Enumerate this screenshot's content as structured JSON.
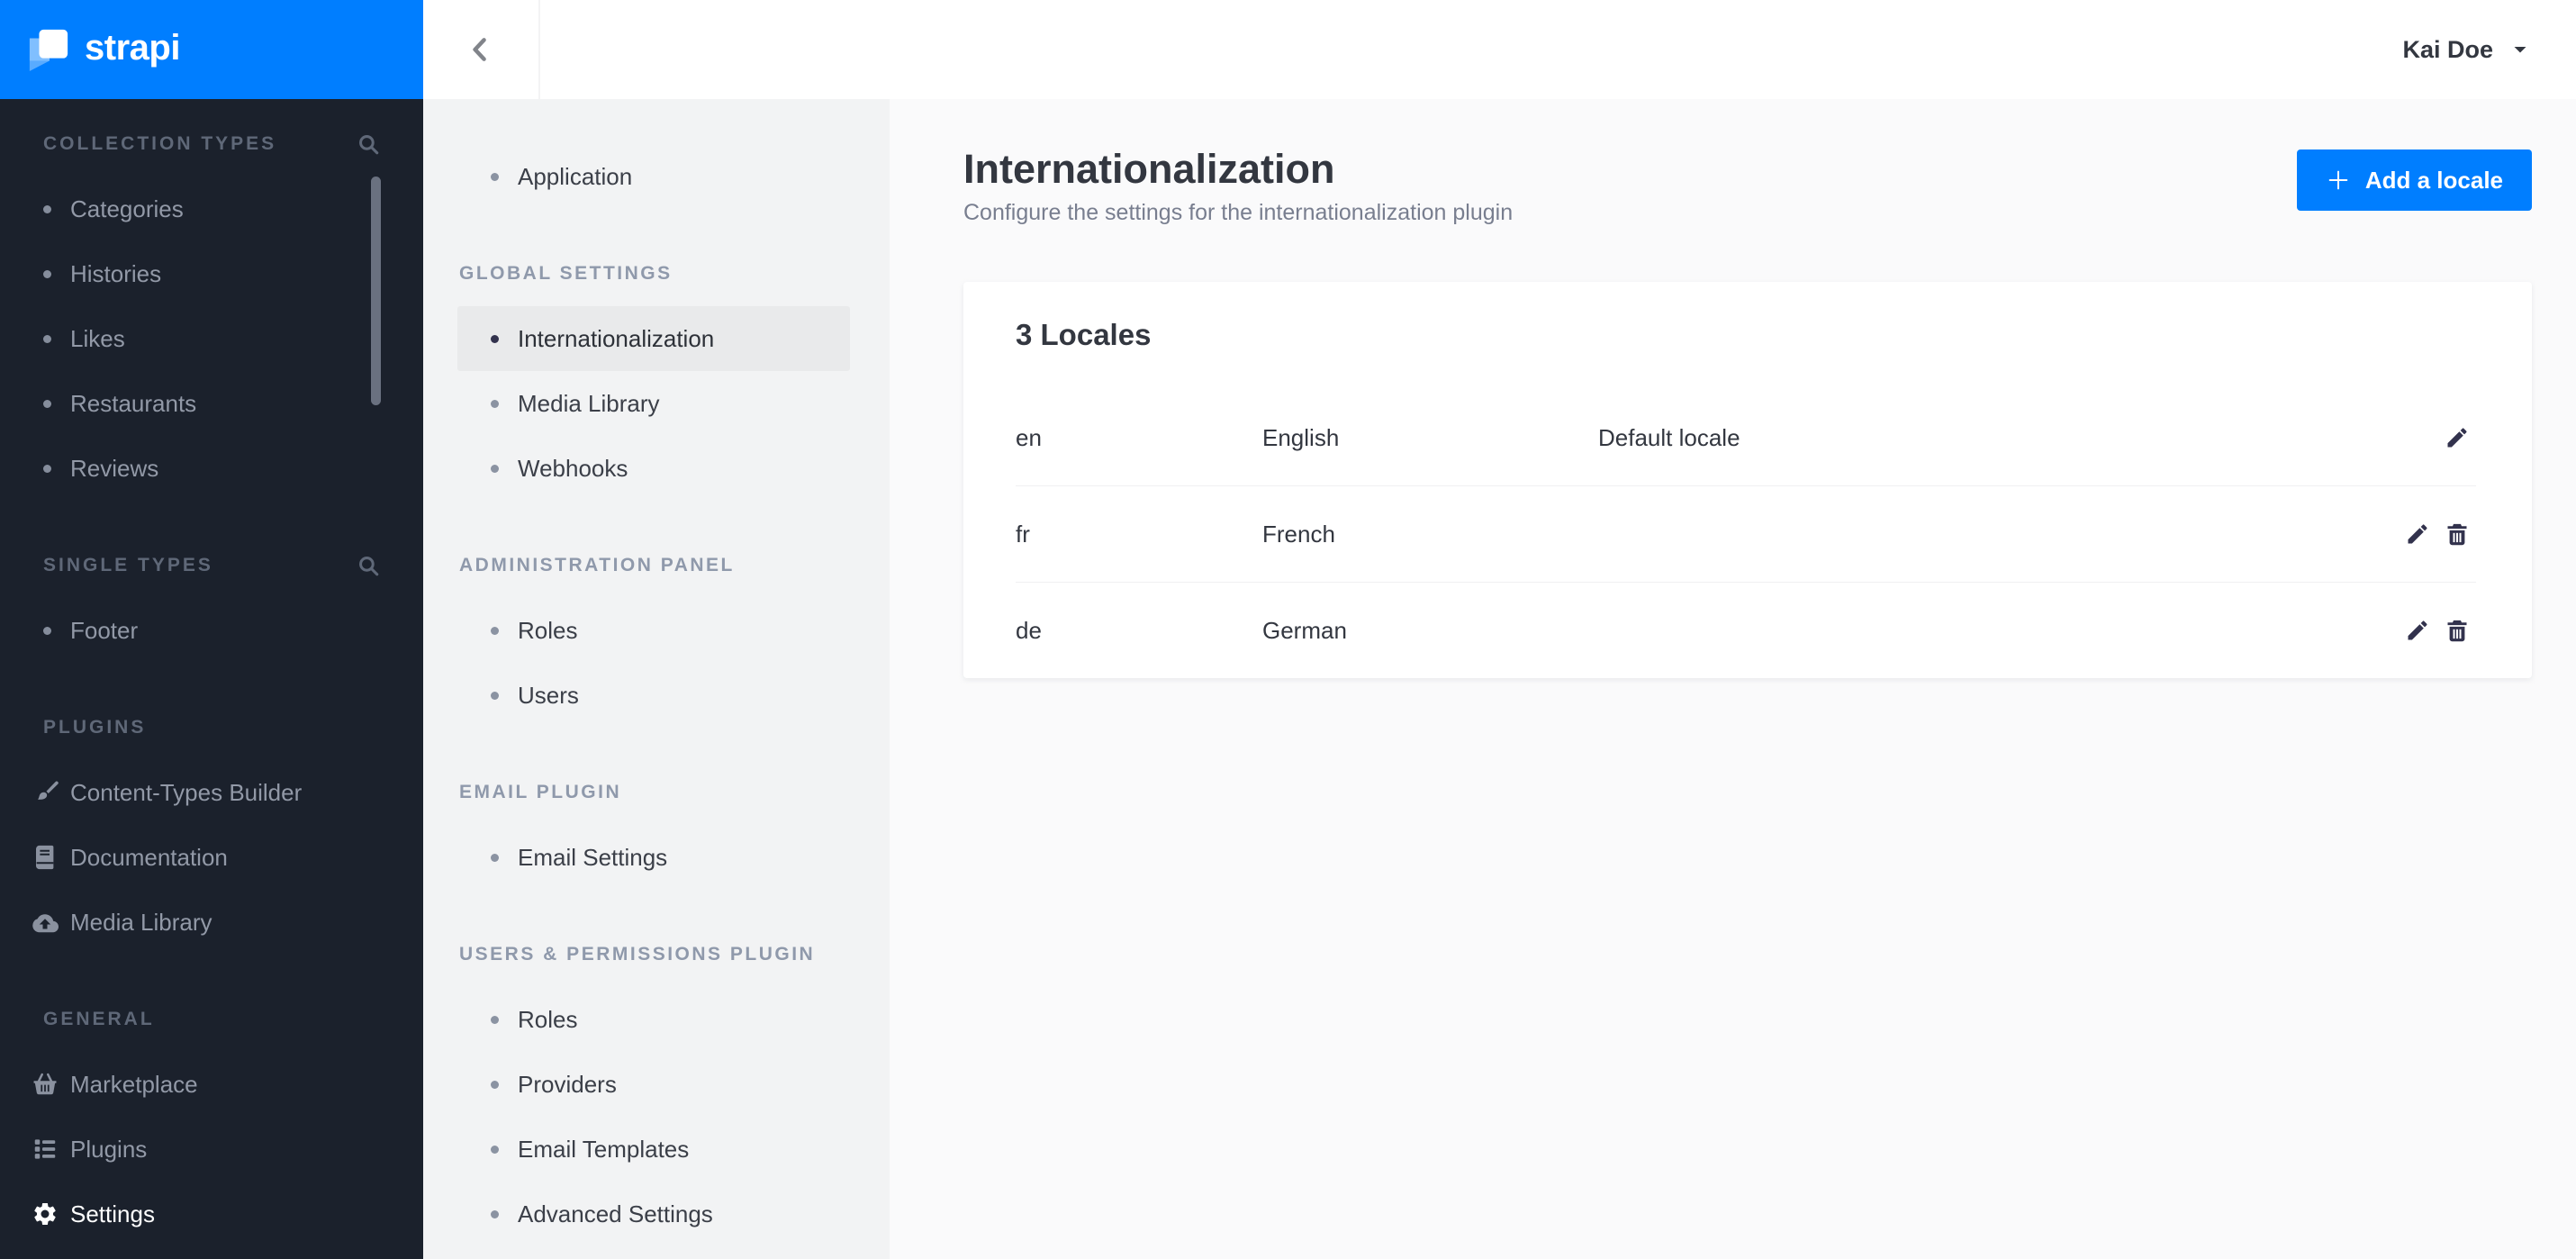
{
  "brand": {
    "name": "strapi",
    "accent_color": "#007eff",
    "sidebar_bg": "#1b212c"
  },
  "topbar": {
    "user_name": "Kai Doe",
    "back_icon": "chevron-left-icon",
    "caret_icon": "caret-down-icon"
  },
  "dark_sidebar": {
    "sections": [
      {
        "label": "COLLECTION TYPES",
        "search": true,
        "items": [
          {
            "label": "Categories"
          },
          {
            "label": "Histories"
          },
          {
            "label": "Likes"
          },
          {
            "label": "Restaurants"
          },
          {
            "label": "Reviews"
          }
        ]
      },
      {
        "label": "SINGLE TYPES",
        "search": true,
        "items": [
          {
            "label": "Footer"
          }
        ]
      },
      {
        "label": "PLUGINS",
        "search": false,
        "items": [
          {
            "label": "Content-Types Builder",
            "icon": "brush-icon"
          },
          {
            "label": "Documentation",
            "icon": "book-icon"
          },
          {
            "label": "Media Library",
            "icon": "cloud-upload-icon"
          }
        ]
      },
      {
        "label": "GENERAL",
        "search": false,
        "items": [
          {
            "label": "Marketplace",
            "icon": "basket-icon"
          },
          {
            "label": "Plugins",
            "icon": "list-icon"
          },
          {
            "label": "Settings",
            "icon": "gear-icon",
            "active": true
          }
        ]
      }
    ]
  },
  "settings_sidebar": {
    "top_items": [
      {
        "label": "Application"
      }
    ],
    "sections": [
      {
        "label": "GLOBAL SETTINGS",
        "items": [
          {
            "label": "Internationalization",
            "active": true
          },
          {
            "label": "Media Library"
          },
          {
            "label": "Webhooks"
          }
        ]
      },
      {
        "label": "ADMINISTRATION PANEL",
        "items": [
          {
            "label": "Roles"
          },
          {
            "label": "Users"
          }
        ]
      },
      {
        "label": "EMAIL PLUGIN",
        "items": [
          {
            "label": "Email Settings"
          }
        ]
      },
      {
        "label": "USERS & PERMISSIONS PLUGIN",
        "items": [
          {
            "label": "Roles"
          },
          {
            "label": "Providers"
          },
          {
            "label": "Email Templates"
          },
          {
            "label": "Advanced Settings"
          }
        ]
      }
    ]
  },
  "page": {
    "title": "Internationalization",
    "subtitle": "Configure the settings for the internationalization plugin",
    "add_button_label": "Add a locale"
  },
  "locales": {
    "count_title": "3 Locales",
    "rows": [
      {
        "code": "en",
        "name": "English",
        "note": "Default locale",
        "can_delete": false
      },
      {
        "code": "fr",
        "name": "French",
        "note": "",
        "can_delete": true
      },
      {
        "code": "de",
        "name": "German",
        "note": "",
        "can_delete": true
      }
    ]
  },
  "colors": {
    "accent": "#007eff",
    "dark_sidebar_bg": "#1b212c",
    "settings_sidebar_bg": "#f2f3f4",
    "selected_item_bg": "#e9eaeb",
    "main_bg": "#fafafb",
    "text_dark": "#333740",
    "text_muted": "#787e8f",
    "separator": "#f0f0f2"
  }
}
